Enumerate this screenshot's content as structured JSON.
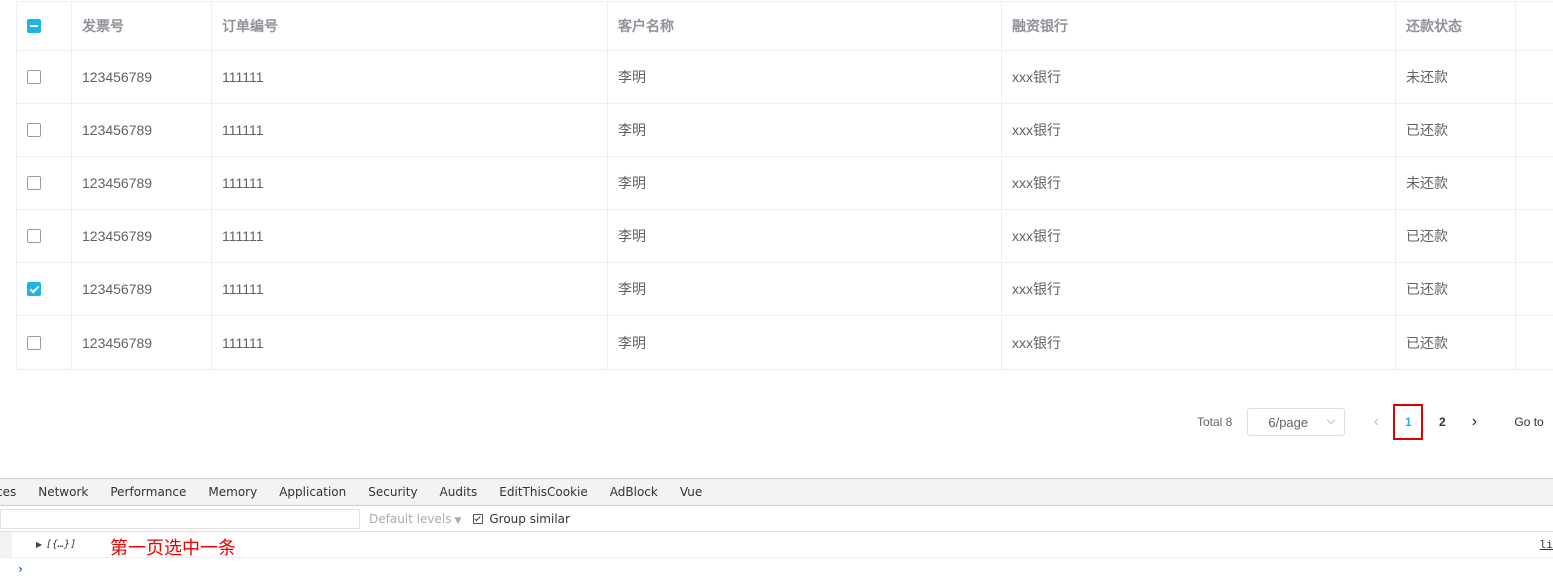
{
  "table": {
    "header_checkbox_state": "indeterminate",
    "columns": [
      "发票号",
      "订单编号",
      "客户名称",
      "融资银行",
      "还款状态",
      ""
    ],
    "rows": [
      {
        "checked": false,
        "invoice": "123456789",
        "order": "111111",
        "customer": "李明",
        "bank": "xxx银行",
        "status": "未还款"
      },
      {
        "checked": false,
        "invoice": "123456789",
        "order": "111111",
        "customer": "李明",
        "bank": "xxx银行",
        "status": "已还款"
      },
      {
        "checked": false,
        "invoice": "123456789",
        "order": "111111",
        "customer": "李明",
        "bank": "xxx银行",
        "status": "未还款"
      },
      {
        "checked": false,
        "invoice": "123456789",
        "order": "111111",
        "customer": "李明",
        "bank": "xxx银行",
        "status": "已还款"
      },
      {
        "checked": true,
        "invoice": "123456789",
        "order": "111111",
        "customer": "李明",
        "bank": "xxx银行",
        "status": "已还款"
      },
      {
        "checked": false,
        "invoice": "123456789",
        "order": "111111",
        "customer": "李明",
        "bank": "xxx银行",
        "status": "已还款"
      }
    ]
  },
  "pagination": {
    "total": "Total 8",
    "page_size": "6/page",
    "prev_icon": "‹",
    "next_icon": "›",
    "pages": [
      "1",
      "2"
    ],
    "current_page": "1",
    "goto_label": "Go to",
    "active_color": "#1cb5e8",
    "highlight_color": "#dd0000"
  },
  "devtools": {
    "tabs": [
      "ces",
      "Network",
      "Performance",
      "Memory",
      "Application",
      "Security",
      "Audits",
      "EditThisCookie",
      "AdBlock",
      "Vue"
    ],
    "levels_label": "Default levels",
    "group_similar_label": "Group similar",
    "group_similar_checked": true,
    "log_object": "[{…}]",
    "annotation": "第一页选中一条",
    "source_link": "li",
    "prompt_icon": "›"
  }
}
